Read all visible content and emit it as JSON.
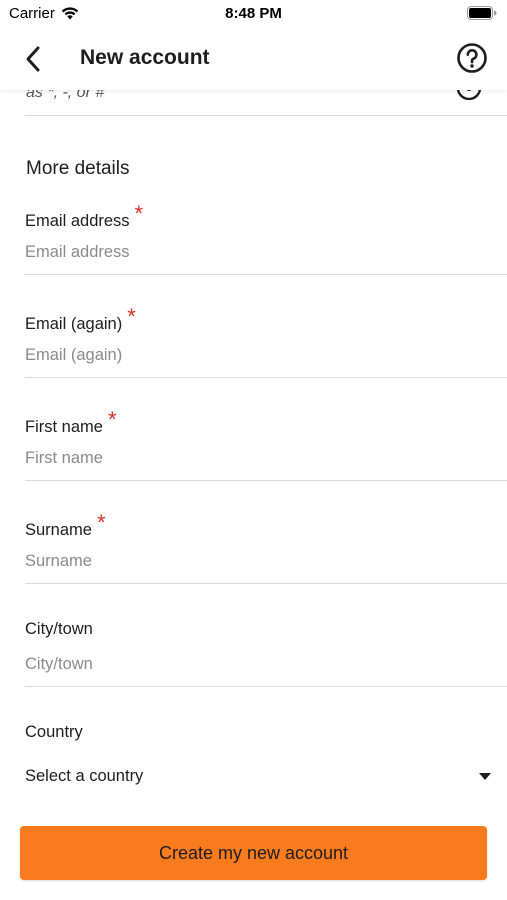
{
  "status_bar": {
    "carrier": "Carrier",
    "time": "8:48 PM"
  },
  "nav": {
    "title": "New account",
    "back_icon": "chevron-left-icon",
    "help_icon": "question-circle-icon"
  },
  "partial_field": {
    "hint_text": "as *, -, or #"
  },
  "section": {
    "title": "More details"
  },
  "fields": {
    "email": {
      "label": "Email address",
      "placeholder": "Email address",
      "required": true
    },
    "email_again": {
      "label": "Email (again)",
      "placeholder": "Email (again)",
      "required": true
    },
    "first_name": {
      "label": "First name",
      "placeholder": "First name",
      "required": true
    },
    "surname": {
      "label": "Surname",
      "placeholder": "Surname",
      "required": true
    },
    "city": {
      "label": "City/town",
      "placeholder": "City/town",
      "required": false
    },
    "country": {
      "label": "Country",
      "selected": "Select a country"
    }
  },
  "required_marker": "*",
  "actions": {
    "create_label": "Create my new account"
  },
  "colors": {
    "accent": "#fa7a1e",
    "required": "#d93025",
    "divider": "#d8d8d8",
    "placeholder": "#8a8a8e"
  }
}
